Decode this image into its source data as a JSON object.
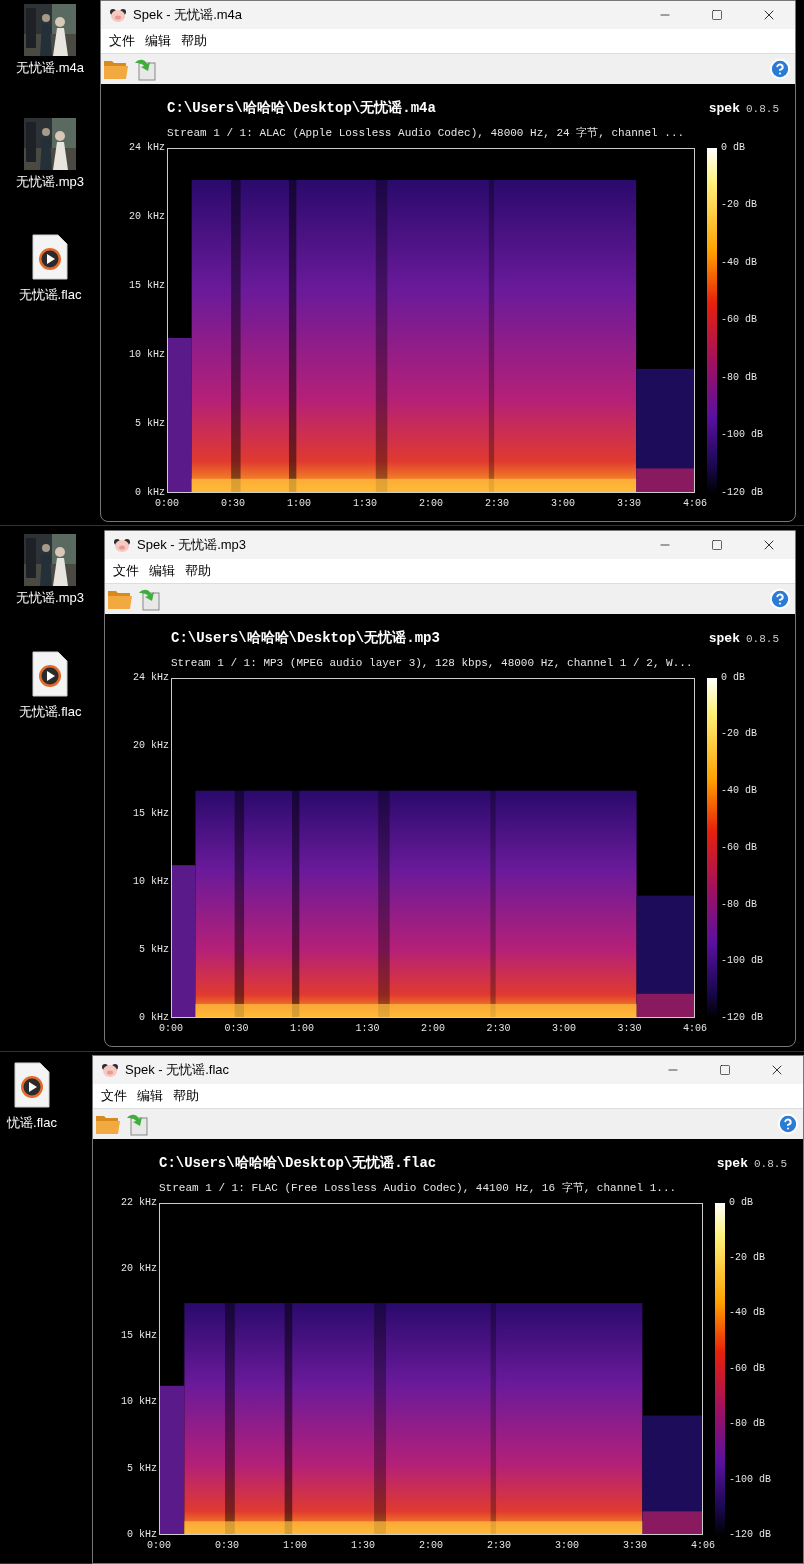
{
  "screenshots": [
    {
      "desktop_icons": [
        {
          "kind": "cover",
          "label": "无忧谣.m4a"
        },
        {
          "kind": "cover",
          "label": "无忧谣.mp3"
        },
        {
          "kind": "audio",
          "label": "无忧谣.flac"
        }
      ],
      "window": {
        "title": "Spek - 无忧谣.m4a",
        "menu": [
          "文件",
          "编辑",
          "帮助"
        ],
        "file_path": "C:\\Users\\哈哈哈\\Desktop\\无忧谣.m4a",
        "app_name": "spek",
        "version": "0.8.5",
        "stream_info": "Stream 1 / 1: ALAC (Apple Lossless Audio Codec), 48000 Hz, 24 字节, channel ...",
        "y_ticks": [
          "24 kHz",
          "20 kHz",
          "15 kHz",
          "10 kHz",
          "5 kHz",
          "0 kHz"
        ],
        "x_ticks": [
          "0:00",
          "0:30",
          "1:00",
          "1:30",
          "2:00",
          "2:30",
          "3:00",
          "3:30",
          "4:06"
        ],
        "db_ticks": [
          "0 dB",
          "-20 dB",
          "-40 dB",
          "-60 dB",
          "-80 dB",
          "-100 dB",
          "-120 dB"
        ]
      }
    },
    {
      "desktop_icons": [
        {
          "kind": "cover",
          "label": "无忧谣.mp3"
        },
        {
          "kind": "audio",
          "label": "无忧谣.flac"
        }
      ],
      "window": {
        "title": "Spek - 无忧谣.mp3",
        "menu": [
          "文件",
          "编辑",
          "帮助"
        ],
        "file_path": "C:\\Users\\哈哈哈\\Desktop\\无忧谣.mp3",
        "app_name": "spek",
        "version": "0.8.5",
        "stream_info": "Stream 1 / 1: MP3 (MPEG audio layer 3), 128 kbps, 48000 Hz, channel 1 / 2, W...",
        "y_ticks": [
          "24 kHz",
          "20 kHz",
          "15 kHz",
          "10 kHz",
          "5 kHz",
          "0 kHz"
        ],
        "x_ticks": [
          "0:00",
          "0:30",
          "1:00",
          "1:30",
          "2:00",
          "2:30",
          "3:00",
          "3:30",
          "4:06"
        ],
        "db_ticks": [
          "0 dB",
          "-20 dB",
          "-40 dB",
          "-60 dB",
          "-80 dB",
          "-100 dB",
          "-120 dB"
        ]
      }
    },
    {
      "desktop_icons": [
        {
          "kind": "audio",
          "label": "忧谣.flac"
        }
      ],
      "window": {
        "title": "Spek - 无忧谣.flac",
        "menu": [
          "文件",
          "编辑",
          "帮助"
        ],
        "file_path": "C:\\Users\\哈哈哈\\Desktop\\无忧谣.flac",
        "app_name": "spek",
        "version": "0.8.5",
        "stream_info": "Stream 1 / 1: FLAC (Free Lossless Audio Codec), 44100 Hz, 16 字节, channel 1...",
        "y_ticks": [
          "22 kHz",
          "20 kHz",
          "15 kHz",
          "10 kHz",
          "5 kHz",
          "0 kHz"
        ],
        "x_ticks": [
          "0:00",
          "0:30",
          "1:00",
          "1:30",
          "2:00",
          "2:30",
          "3:00",
          "3:30",
          "4:06"
        ],
        "db_ticks": [
          "0 dB",
          "-20 dB",
          "-40 dB",
          "-60 dB",
          "-80 dB",
          "-100 dB",
          "-120 dB"
        ]
      }
    }
  ]
}
